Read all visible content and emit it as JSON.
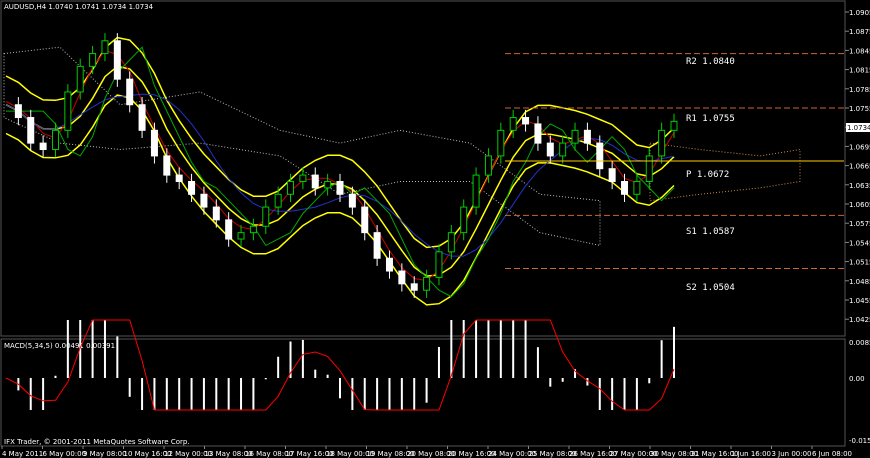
{
  "window": {
    "symbol_header": "AUDUSD,H4  1.0740 1.0741 1.0734 1.0734",
    "current_price": "1.0734",
    "copyright": "IFX Trader, © 2001-2011 MetaQuotes Software Corp."
  },
  "macd": {
    "label": "MACD(5,34,5) 0.00491 0.00391",
    "scale": [
      "0.00855",
      "0.00",
      "-0.01574"
    ]
  },
  "price_axis": [
    "1.0905",
    "1.0875",
    "1.0845",
    "1.0815",
    "1.0785",
    "1.0755",
    "1.0725",
    "1.0695",
    "1.0665",
    "1.0635",
    "1.0605",
    "1.0575",
    "1.0545",
    "1.0515",
    "1.0485",
    "1.0455",
    "1.0425"
  ],
  "time_axis": [
    "4 May 2011",
    "6 May 00:00",
    "9 May 08:00",
    "10 May 16:00",
    "12 May 00:00",
    "13 May 08:00",
    "16 May 08:00",
    "17 May 16:00",
    "18 May 00:00",
    "19 May 08:00",
    "20 May 08:00",
    "20 May 16:00",
    "24 May 00:00",
    "25 May 08:00",
    "26 May 16:00",
    "27 May 00:00",
    "30 May 08:00",
    "31 May 16:00",
    "1 Jun 16:00",
    "3 Jun 00:00",
    "6 Jun 08:00"
  ],
  "pivots": {
    "R2": "R2 1.0840",
    "R1": "R1 1.0755",
    "P": "P 1.0672",
    "S1": "S1 1.0587",
    "S2": "S2 1.0504"
  },
  "colors": {
    "candle_up": "#00cc00",
    "candle_down": "#ffffff",
    "bollinger": "#ffff00",
    "pivot_p": "#ffcc00",
    "resistance": "#cc6633",
    "support": "#cc6633",
    "macd_hist": "#ffffff",
    "macd_signal": "#ff0000"
  }
}
